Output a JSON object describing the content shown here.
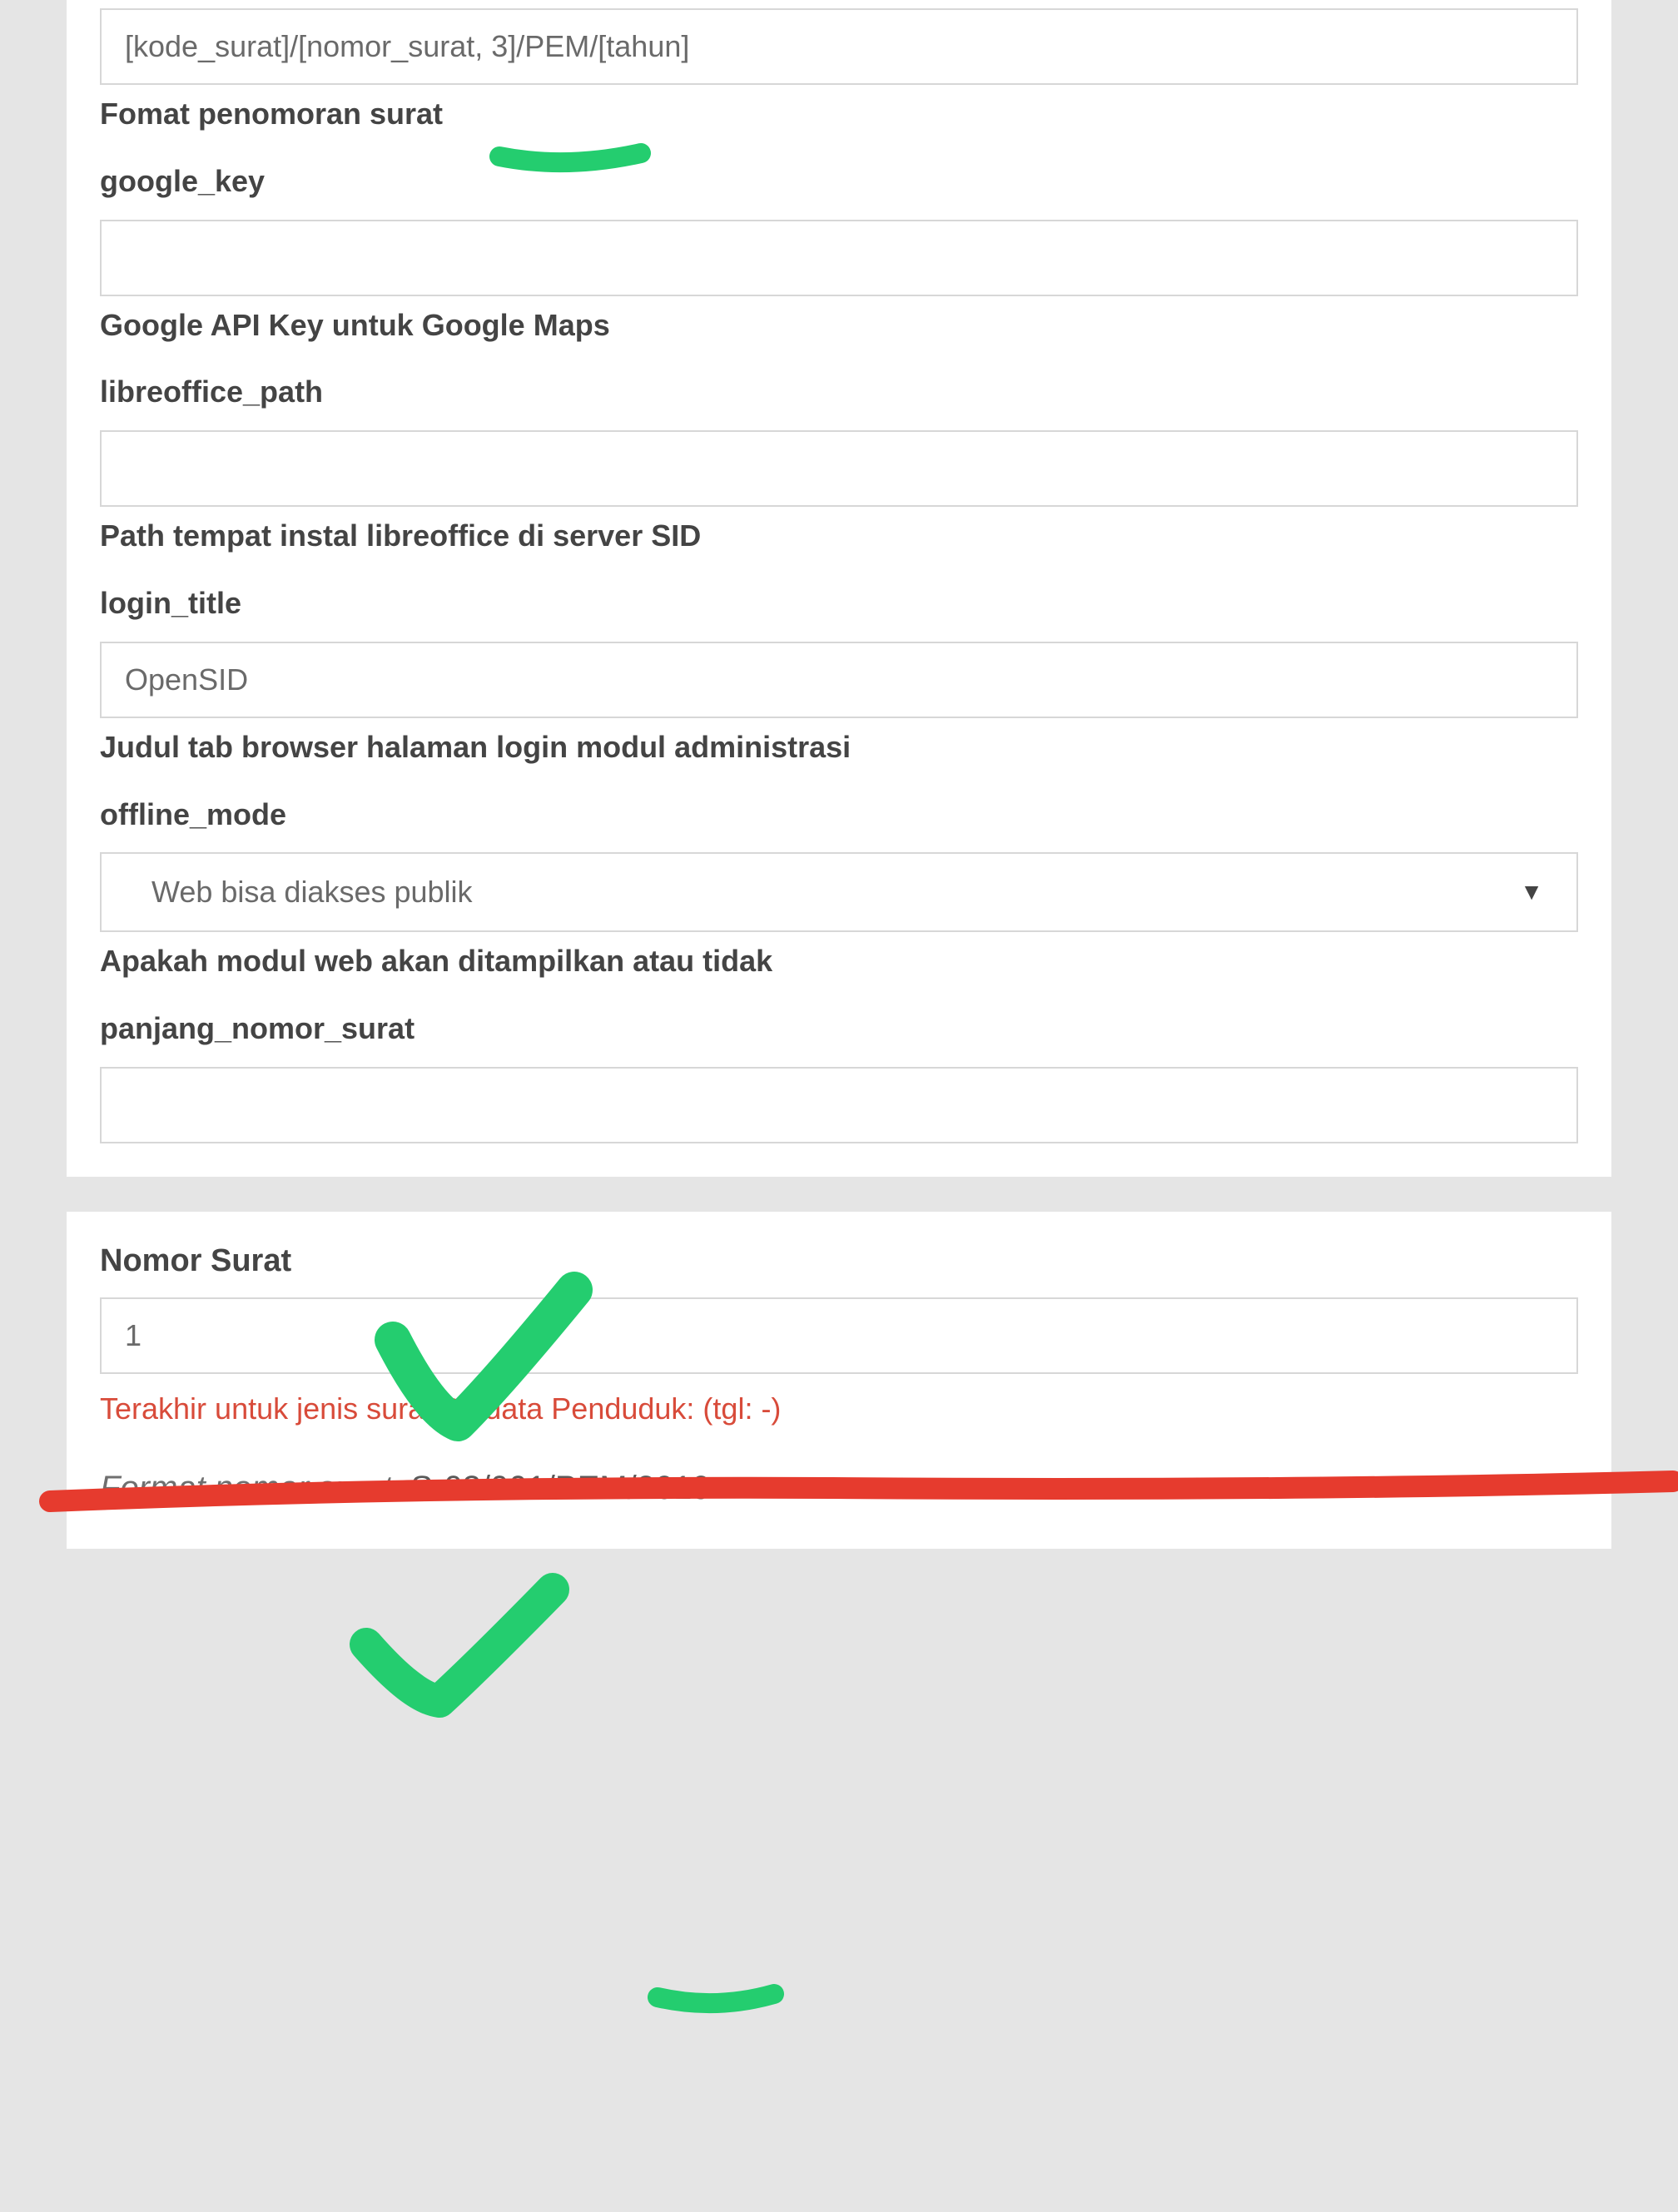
{
  "field1": {
    "value": "[kode_surat]/[nomor_surat, 3]/PEM/[tahun]",
    "help": "Fomat penomoran surat"
  },
  "google_key": {
    "name": "google_key",
    "value": "",
    "help": "Google API Key untuk Google Maps"
  },
  "libreoffice_path": {
    "name": "libreoffice_path",
    "value": "",
    "help": "Path tempat instal libreoffice di server SID"
  },
  "login_title": {
    "name": "login_title",
    "value": "OpenSID",
    "help": "Judul tab browser halaman login modul administrasi"
  },
  "offline_mode": {
    "name": "offline_mode",
    "selected": "Web bisa diakses publik",
    "help": "Apakah modul web akan ditampilkan atau tidak"
  },
  "panjang_nomor_surat": {
    "name": "panjang_nomor_surat",
    "value": ""
  },
  "nomor_surat": {
    "label": "Nomor Surat",
    "value": "1",
    "status": "Terakhir untuk jenis surat Biodata Penduduk: (tgl: -)"
  },
  "format_line": {
    "label": "Format nomor surat:",
    "value": " S-03/001/PEM/2019"
  }
}
